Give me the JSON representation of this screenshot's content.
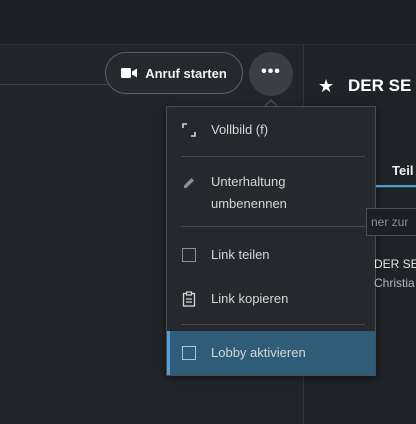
{
  "header": {
    "call_button_label": "Anruf starten",
    "more_button_glyph": "•••",
    "camera_icon": "video-camera-icon"
  },
  "menu": {
    "items": [
      {
        "label": "Vollbild (f)",
        "icon": "fullscreen-icon"
      },
      {
        "label": "Unterhaltung umbenennen",
        "line1": "Unterhaltung",
        "line2": "umbenennen",
        "icon": "pencil-icon"
      },
      {
        "label": "Link teilen",
        "icon": "checkbox-icon",
        "checked": false
      },
      {
        "label": "Link kopieren",
        "icon": "clipboard-icon"
      },
      {
        "label": "Lobby aktivieren",
        "icon": "checkbox-icon",
        "checked": false,
        "highlighted": true
      }
    ]
  },
  "sidebar": {
    "star_glyph": "★",
    "room_title": "DER SE",
    "tab_label": "Teil",
    "search_placeholder": "ner zur",
    "participant_name": "DER SE",
    "participant_sub": "Christia"
  },
  "colors": {
    "accent": "#4aa3d6",
    "highlight": "#2f5d77",
    "background": "#202428"
  }
}
